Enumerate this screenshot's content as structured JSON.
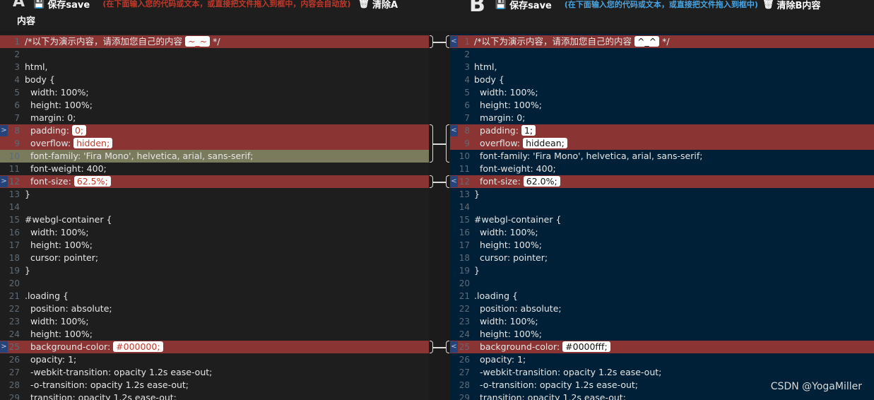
{
  "header": {
    "a": {
      "letter": "A",
      "save_label": "保存save",
      "hint": "(在下面输入您的代码或文本，或直接把文件拖入到框中，内容会自动放)",
      "clear_label": "清除A",
      "clear_label_cont": "内容"
    },
    "b": {
      "letter": "B",
      "save_label": "保存save",
      "hint": "(在下面输入您的代码或文本，或直接把文件拖入到框中)",
      "clear_label": "清除B内容"
    },
    "save_icon": "floppy-disk-icon",
    "clear_icon": "trash-icon"
  },
  "colors": {
    "pane_a_bg": "#1e1e1e",
    "pane_b_bg": "#002037",
    "changed_line": "#8b3434",
    "changed_line_alt": "#7a7a5c",
    "hint_a": "#c0392b",
    "hint_b": "#4aa3df"
  },
  "pane_a": {
    "lines": [
      {
        "n": "1",
        "pre": "/*以下为演示内容，请添加您自己的内容 ",
        "pill": "~_~",
        "post": " */",
        "state": "changed"
      },
      {
        "n": "2",
        "pre": ""
      },
      {
        "n": "3",
        "pre": "html,"
      },
      {
        "n": "4",
        "pre": "body {"
      },
      {
        "n": "5",
        "pre": "  width: 100%;"
      },
      {
        "n": "6",
        "pre": "  height: 100%;"
      },
      {
        "n": "7",
        "pre": "  margin: 0;"
      },
      {
        "n": "8",
        "pre": "  padding: ",
        "pill": "0;",
        "state": "changed",
        "marker": true
      },
      {
        "n": "9",
        "pre": "  overflow: ",
        "pill": "hidden;",
        "state": "changed"
      },
      {
        "n": "10",
        "pre": "  font-family: 'Fira Mono', helvetica, arial, sans-serif;",
        "state": "changed-a-alt"
      },
      {
        "n": "11",
        "pre": "  font-weight: 400;"
      },
      {
        "n": "12",
        "pre": "  font-size: ",
        "pill": "62.5%;",
        "state": "changed",
        "marker": true
      },
      {
        "n": "13",
        "pre": "}"
      },
      {
        "n": "14",
        "pre": ""
      },
      {
        "n": "15",
        "pre": "#webgl-container {"
      },
      {
        "n": "16",
        "pre": "  width: 100%;"
      },
      {
        "n": "17",
        "pre": "  height: 100%;"
      },
      {
        "n": "18",
        "pre": "  cursor: pointer;"
      },
      {
        "n": "19",
        "pre": "}"
      },
      {
        "n": "20",
        "pre": ""
      },
      {
        "n": "21",
        "pre": ".loading {"
      },
      {
        "n": "22",
        "pre": "  position: absolute;"
      },
      {
        "n": "23",
        "pre": "  width: 100%;"
      },
      {
        "n": "24",
        "pre": "  height: 100%;"
      },
      {
        "n": "25",
        "pre": "  background-color: ",
        "pill": "#000000;",
        "state": "changed",
        "marker": true
      },
      {
        "n": "26",
        "pre": "  opacity: 1;"
      },
      {
        "n": "27",
        "pre": "  -webkit-transition: opacity 1.2s ease-out;"
      },
      {
        "n": "28",
        "pre": "  -o-transition: opacity 1.2s ease-out;"
      },
      {
        "n": "29",
        "pre": "  transition: opacity 1.2s ease-out;"
      }
    ]
  },
  "pane_b": {
    "lines": [
      {
        "n": "1",
        "pre": "/*以下为演示内容，请添加您自己的内容 ",
        "pill": "^_^",
        "post": " */",
        "state": "changed",
        "marker": true
      },
      {
        "n": "2",
        "pre": ""
      },
      {
        "n": "3",
        "pre": "html,"
      },
      {
        "n": "4",
        "pre": "body {"
      },
      {
        "n": "5",
        "pre": "  width: 100%;"
      },
      {
        "n": "6",
        "pre": "  height: 100%;"
      },
      {
        "n": "7",
        "pre": "  margin: 0;"
      },
      {
        "n": "8",
        "pre": "  padding: ",
        "pill": "1;",
        "state": "changed",
        "marker": true
      },
      {
        "n": "9",
        "pre": "  overflow: ",
        "pill": "hiddean;",
        "state": "changed"
      },
      {
        "n": "10",
        "pre": "  font-family: 'Fira Mono', helvetica, arial, sans-serif;"
      },
      {
        "n": "11",
        "pre": "  font-weight: 400;"
      },
      {
        "n": "12",
        "pre": "  font-size: ",
        "pill": "62.0%;",
        "state": "changed",
        "marker": true
      },
      {
        "n": "13",
        "pre": "}"
      },
      {
        "n": "14",
        "pre": ""
      },
      {
        "n": "15",
        "pre": "#webgl-container {"
      },
      {
        "n": "16",
        "pre": "  width: 100%;"
      },
      {
        "n": "17",
        "pre": "  height: 100%;"
      },
      {
        "n": "18",
        "pre": "  cursor: pointer;"
      },
      {
        "n": "19",
        "pre": "}"
      },
      {
        "n": "20",
        "pre": ""
      },
      {
        "n": "21",
        "pre": ".loading {"
      },
      {
        "n": "22",
        "pre": "  position: absolute;"
      },
      {
        "n": "23",
        "pre": "  width: 100%;"
      },
      {
        "n": "24",
        "pre": "  height: 100%;"
      },
      {
        "n": "25",
        "pre": "  background-color: ",
        "pill": "#0000fff;",
        "state": "changed",
        "marker": true
      },
      {
        "n": "26",
        "pre": "  opacity: 1;"
      },
      {
        "n": "27",
        "pre": "  -webkit-transition: opacity 1.2s ease-out;"
      },
      {
        "n": "28",
        "pre": "  -o-transition: opacity 1.2s ease-out;"
      },
      {
        "n": "29",
        "pre": "  transition: opacity 1.2s ease-out;"
      }
    ]
  },
  "markers": {
    "a_symbol": ">",
    "b_symbol": "<"
  },
  "watermark": "CSDN @YogaMiller"
}
